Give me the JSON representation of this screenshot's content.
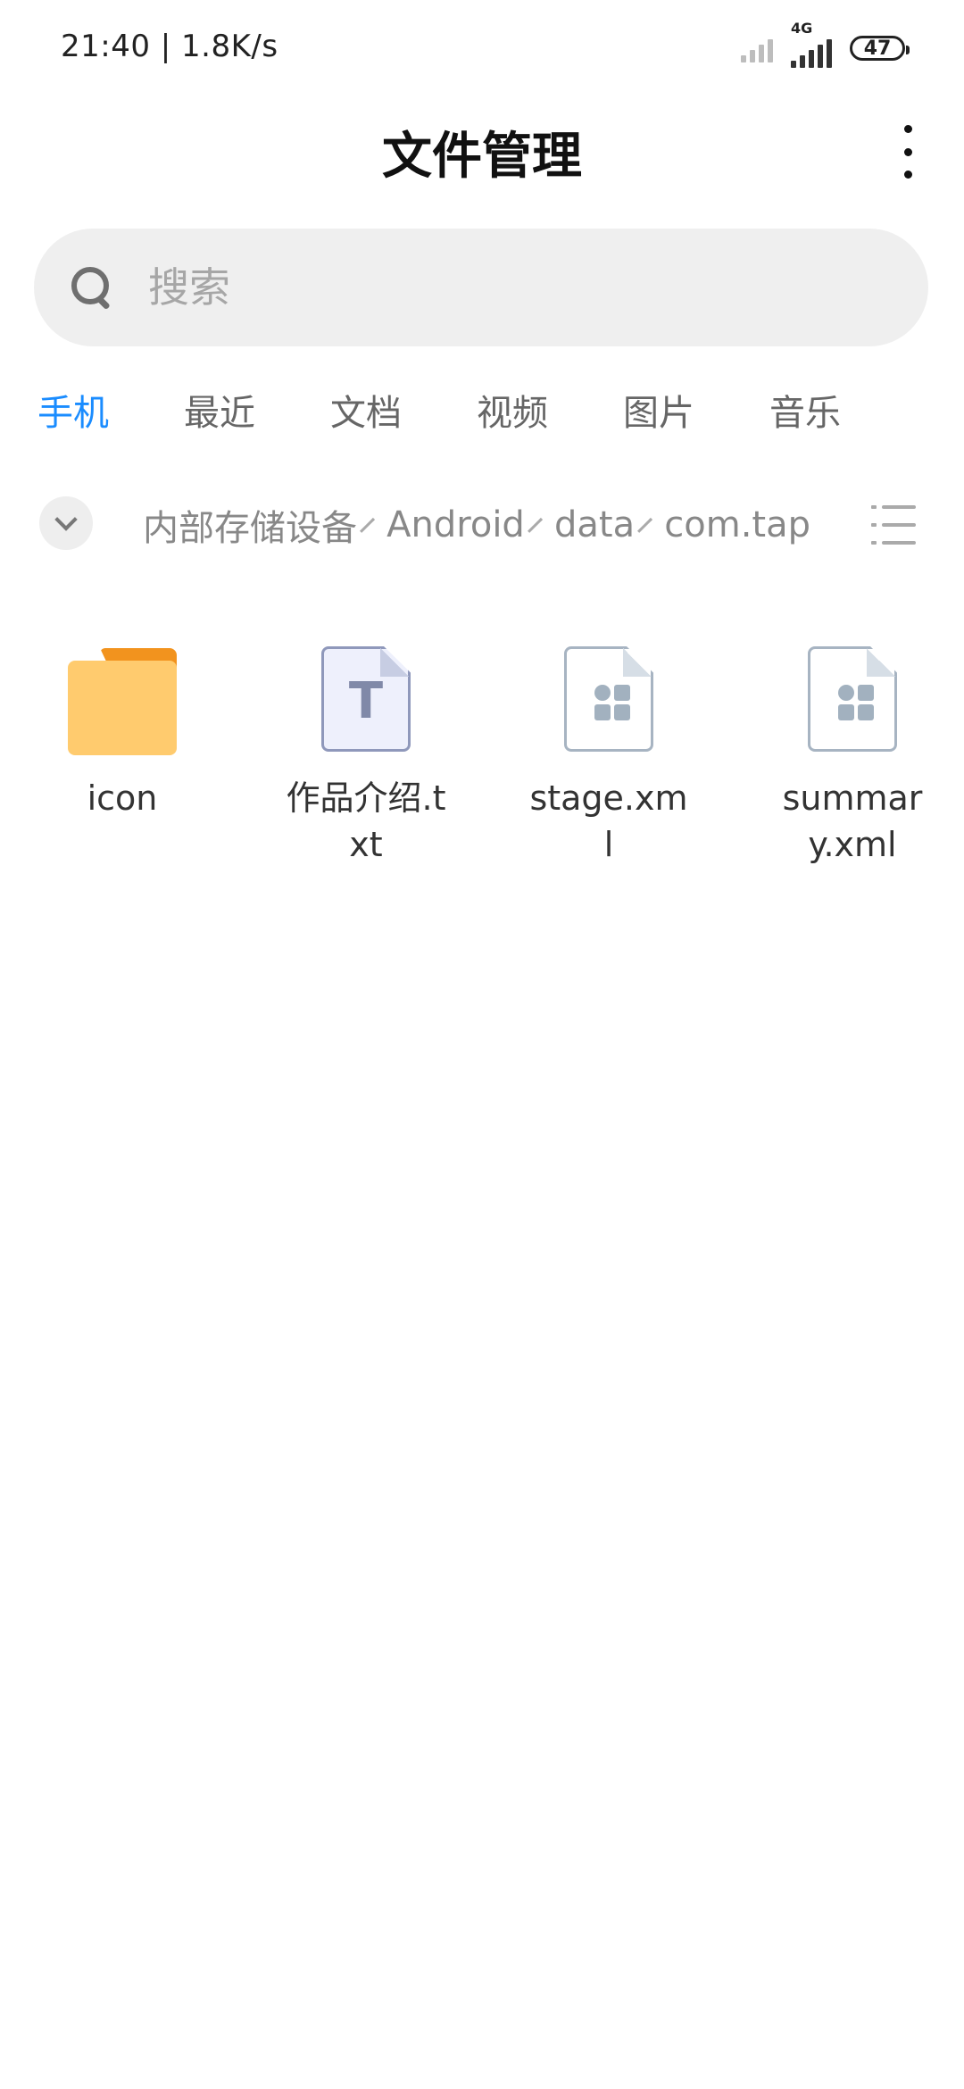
{
  "status_bar": {
    "time": "21:40 | 1.8K/s",
    "network_type": "4G",
    "battery": "47"
  },
  "header": {
    "title": "文件管理"
  },
  "search": {
    "placeholder": "搜索"
  },
  "tabs": [
    {
      "label": "手机",
      "active": true
    },
    {
      "label": "最近",
      "active": false
    },
    {
      "label": "文档",
      "active": false
    },
    {
      "label": "视频",
      "active": false
    },
    {
      "label": "图片",
      "active": false
    },
    {
      "label": "音乐",
      "active": false
    }
  ],
  "breadcrumb": [
    "内部存储设备",
    "Android",
    "data",
    "com.tap"
  ],
  "files": [
    {
      "name": "icon",
      "type": "folder",
      "icon": "folder-icon"
    },
    {
      "name": "作品介绍.txt",
      "type": "text",
      "icon": "text-file-icon"
    },
    {
      "name": "stage.xml",
      "type": "xml",
      "icon": "xml-file-icon"
    },
    {
      "name": "summary.xml",
      "type": "xml",
      "icon": "xml-file-icon"
    }
  ],
  "colors": {
    "accent": "#1a8cff",
    "folder": "#ffcb6e",
    "folder_tab": "#f2931e",
    "search_bg": "#efefef"
  }
}
